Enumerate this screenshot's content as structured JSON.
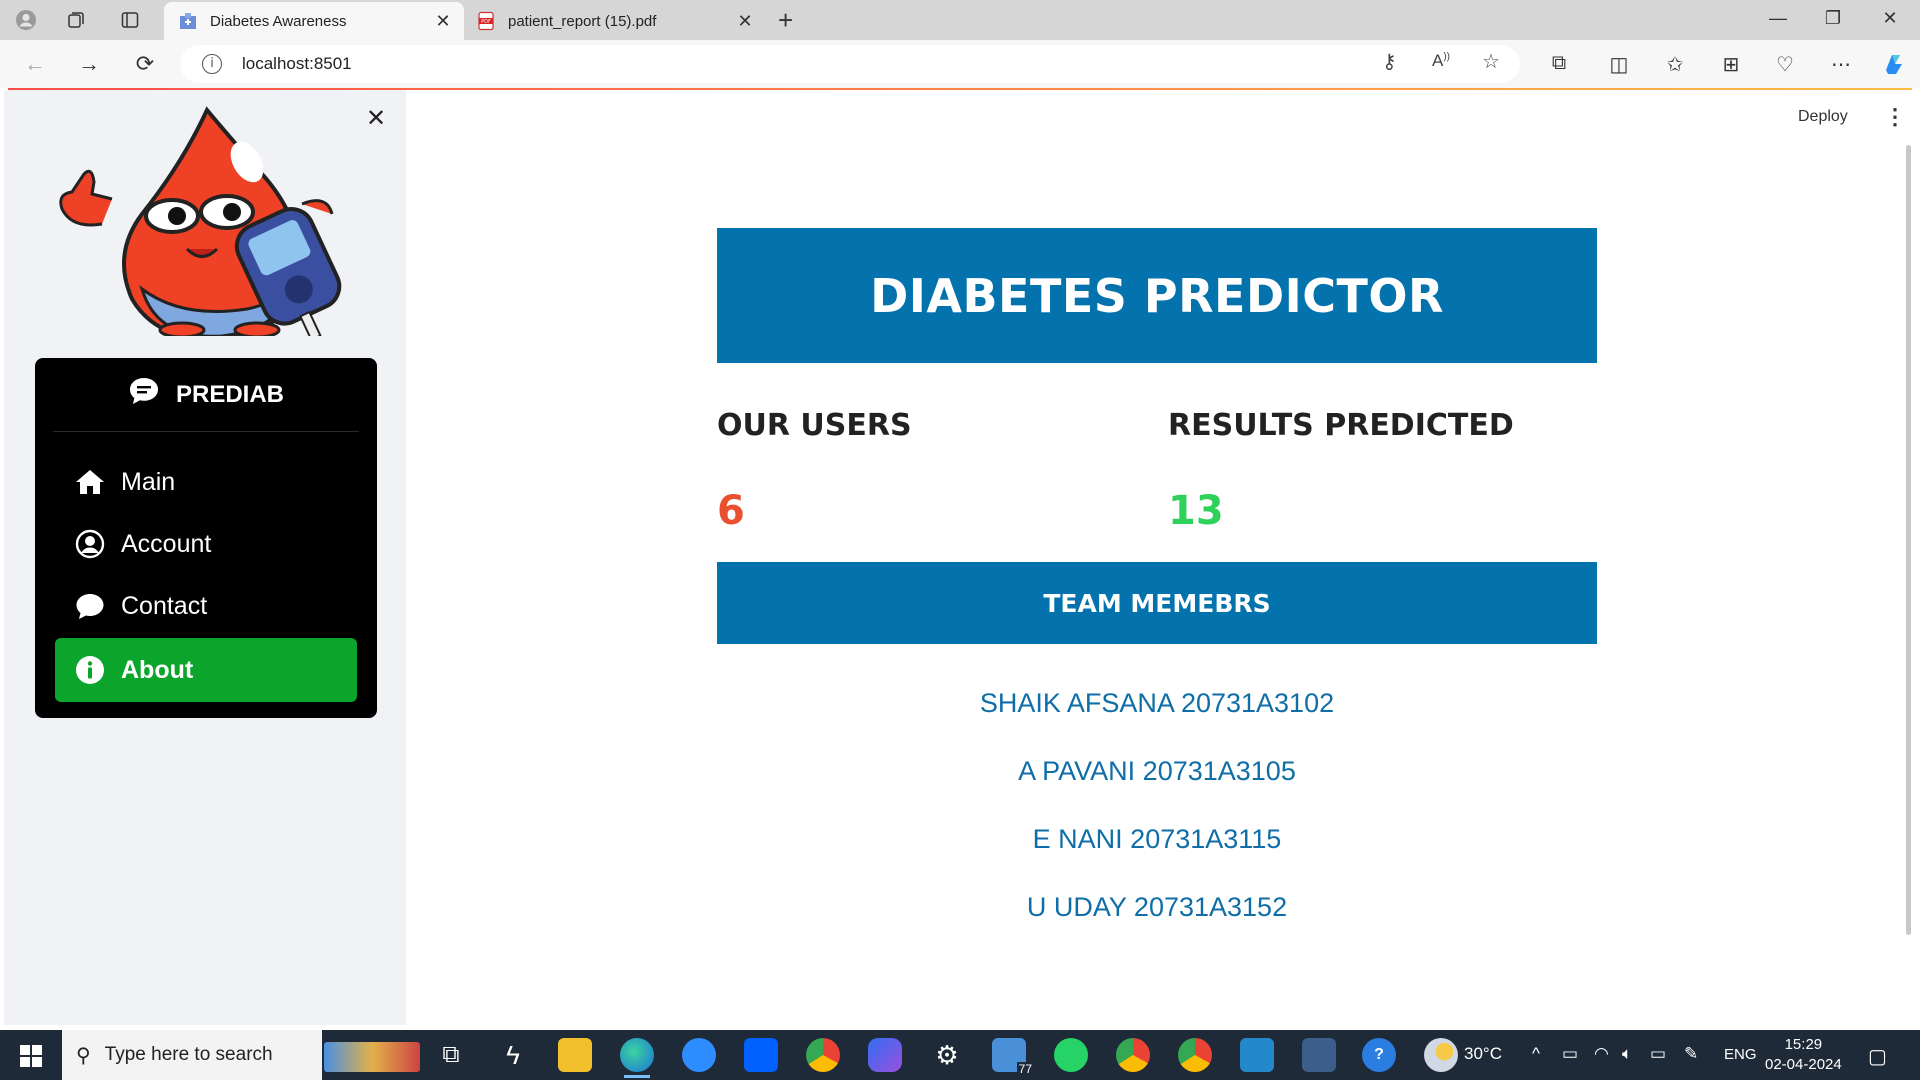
{
  "browser": {
    "tabs": [
      {
        "title": "Diabetes Awareness",
        "icon": "hospital-tab-icon",
        "active": true
      },
      {
        "title": "patient_report (15).pdf",
        "icon": "pdf-tab-icon",
        "active": false
      }
    ],
    "url": "localhost:8501"
  },
  "sidebar": {
    "menu_title": "PREDIAB",
    "items": [
      {
        "label": "Main",
        "icon": "home-icon",
        "selected": false
      },
      {
        "label": "Account",
        "icon": "user-circle-icon",
        "selected": false
      },
      {
        "label": "Contact",
        "icon": "chat-bubble-icon",
        "selected": false
      },
      {
        "label": "About",
        "icon": "info-icon",
        "selected": true
      }
    ],
    "selected_color": "#0ba52b"
  },
  "header": {
    "deploy_label": "Deploy"
  },
  "main": {
    "title": "DIABETES PREDICTOR",
    "metrics": [
      {
        "label": "OUR USERS",
        "value": "6",
        "color": "#e8502f"
      },
      {
        "label": "RESULTS PREDICTED",
        "value": "13",
        "color": "#2fd15b"
      }
    ],
    "team_heading": "TEAM MEMEBRS",
    "members": [
      "SHAIK AFSANA 20731A3102",
      "A PAVANI 20731A3105",
      "E NANI 20731A3115",
      "U UDAY 20731A3152"
    ],
    "accent": "#0372ad"
  },
  "taskbar": {
    "search_placeholder": "Type here to search",
    "weather": "30°C",
    "language": "ENG",
    "time": "15:29",
    "date": "02-04-2024",
    "mail_badge": "77"
  }
}
